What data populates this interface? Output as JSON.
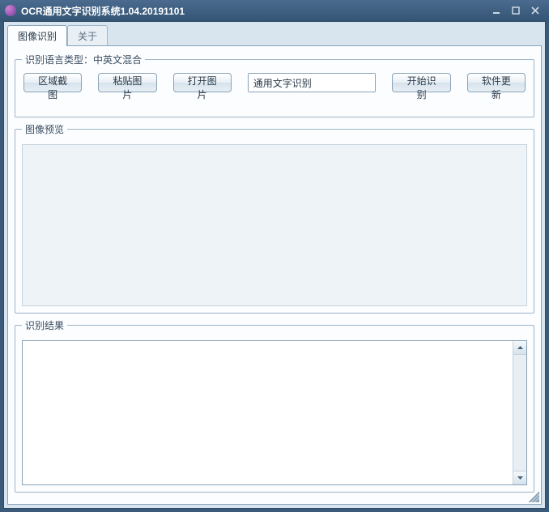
{
  "window": {
    "title": "OCR通用文字识别系统1.04.20191101"
  },
  "tabs": {
    "image": "图像识别",
    "about": "关于"
  },
  "lang": {
    "legend": "识别语言类型：中英文混合"
  },
  "toolbar": {
    "capture": "区域截图",
    "paste": "粘贴图片",
    "open": "打开图片",
    "mode_value": "通用文字识别",
    "start": "开始识别",
    "update": "软件更新"
  },
  "preview": {
    "legend": "图像预览"
  },
  "result": {
    "legend": "识别结果",
    "text": ""
  }
}
